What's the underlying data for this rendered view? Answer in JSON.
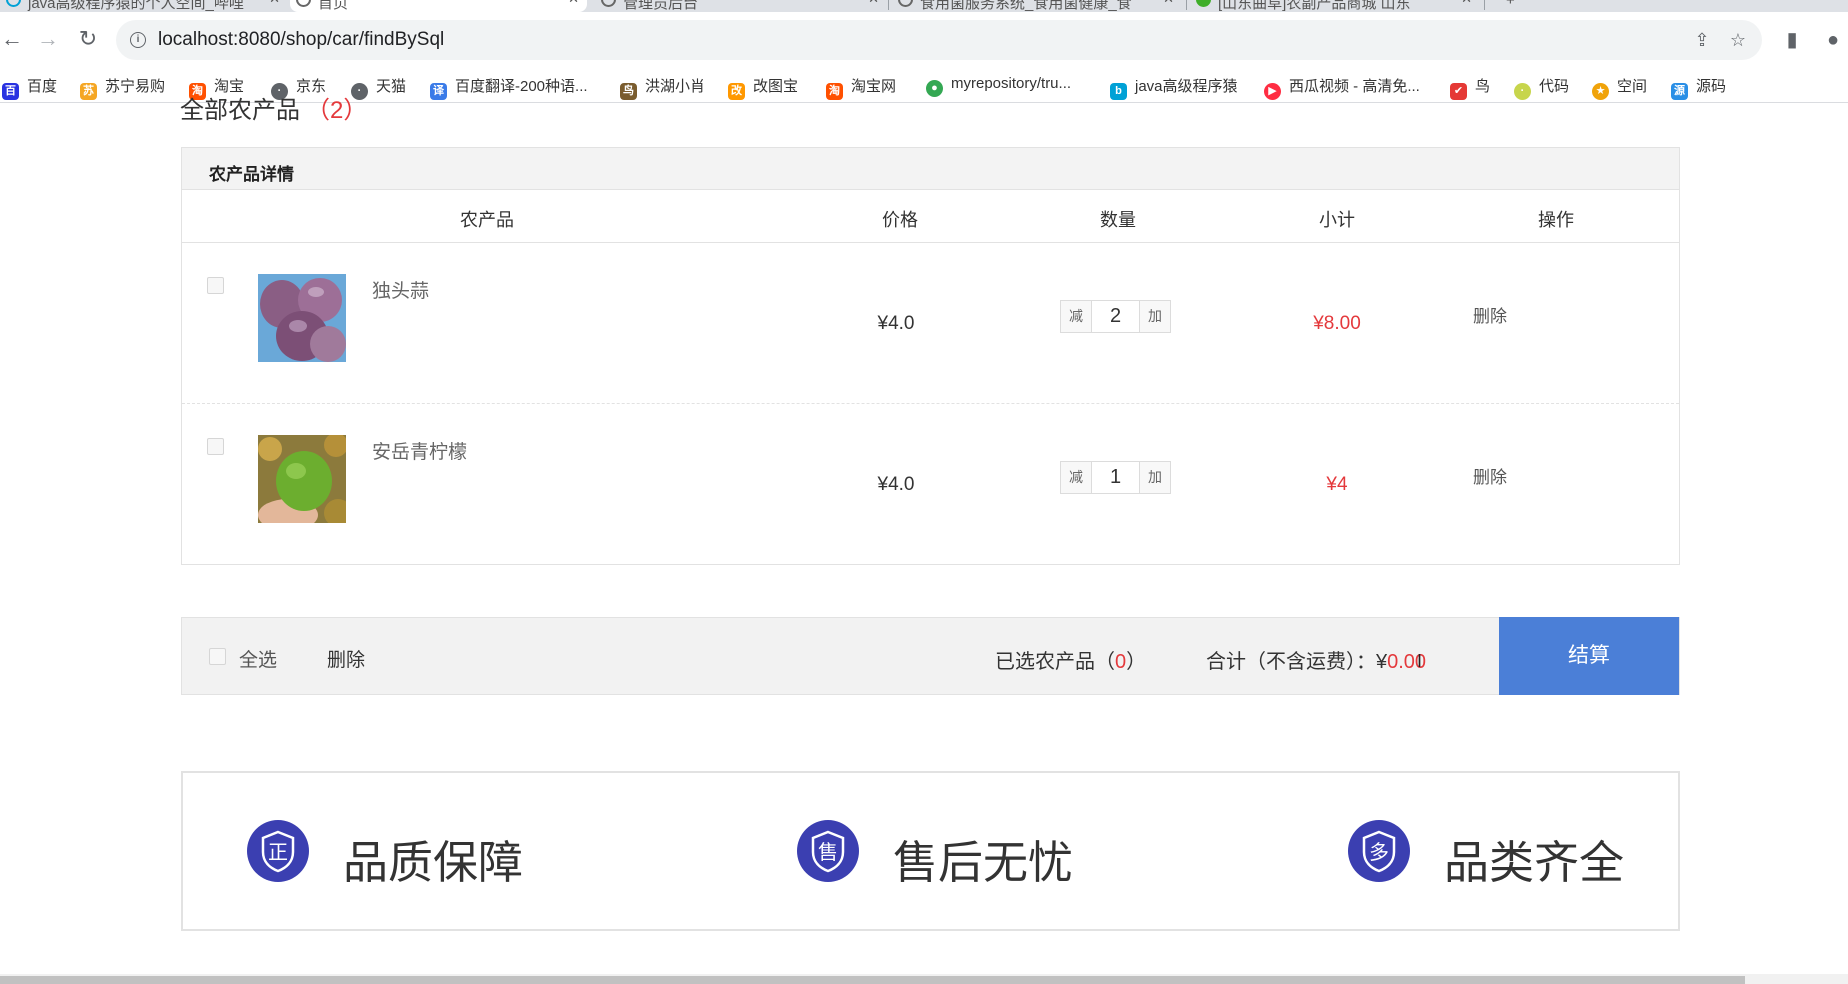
{
  "browser": {
    "tabs": [
      {
        "label": "java高级程序猿的个人空间_哔哩"
      },
      {
        "label": "首页"
      },
      {
        "label": "管理员后台"
      },
      {
        "label": "食用菌服务系统_食用菌健康_食"
      },
      {
        "label": "[山东曲阜]农副产品商城 山东"
      }
    ],
    "url": "localhost:8080/shop/car/findBySql",
    "bookmarks": [
      {
        "label": "百度",
        "color": "#2932e1"
      },
      {
        "label": "苏宁易购",
        "color": "#f5a623"
      },
      {
        "label": "淘宝",
        "color": "#ff5000"
      },
      {
        "label": "京东",
        "color": "#5f6368"
      },
      {
        "label": "天猫",
        "color": "#5f6368"
      },
      {
        "label": "百度翻译-200种语...",
        "color": "#3a7be8"
      },
      {
        "label": "洪湖小肖",
        "color": "#7a5c2e"
      },
      {
        "label": "改图宝",
        "color": "#ff9800"
      },
      {
        "label": "淘宝网",
        "color": "#ff5000"
      },
      {
        "label": "myrepository/tru...",
        "color": "#34a853"
      },
      {
        "label": "java高级程序猿",
        "color": "#00a1d6"
      },
      {
        "label": "西瓜视频 - 高清免...",
        "color": "#ff2d42"
      },
      {
        "label": "鸟",
        "color": "#e53935"
      },
      {
        "label": "代码",
        "color": "#c7d54c"
      },
      {
        "label": "空间",
        "color": "#f0a30a"
      },
      {
        "label": "源码",
        "color": "#2a8fe6"
      }
    ]
  },
  "page": {
    "heading": "全部农产品",
    "heading_count": "（2）"
  },
  "cart": {
    "caption": "农产品详情",
    "columns": [
      "农产品",
      "价格",
      "数量",
      "小计",
      "操作"
    ],
    "items": [
      {
        "name": "独头蒜",
        "price": "¥4.0",
        "qty": "2",
        "subtotal": "¥8.00",
        "dec": "减",
        "inc": "加",
        "delete": "删除"
      },
      {
        "name": "安岳青柠檬",
        "price": "¥4.0",
        "qty": "1",
        "subtotal": "¥4",
        "dec": "减",
        "inc": "加",
        "delete": "删除"
      }
    ]
  },
  "summary": {
    "select_all": "全选",
    "delete": "删除",
    "selected_label": "已选农产品（",
    "selected_count": "0",
    "selected_close": "）",
    "total_label": "合计（不含运费）：",
    "total_currency": "¥",
    "total_value": "0.00",
    "checkout": "结算"
  },
  "promises": [
    {
      "text": "品质保障",
      "badge_char": "正"
    },
    {
      "text": "售后无忧",
      "badge_char": "售"
    },
    {
      "text": "品类齐全",
      "badge_char": "多"
    }
  ],
  "colors": {
    "accent": "#4b7fd7",
    "price_red": "#e4393c",
    "badge": "#3b3fb1"
  }
}
